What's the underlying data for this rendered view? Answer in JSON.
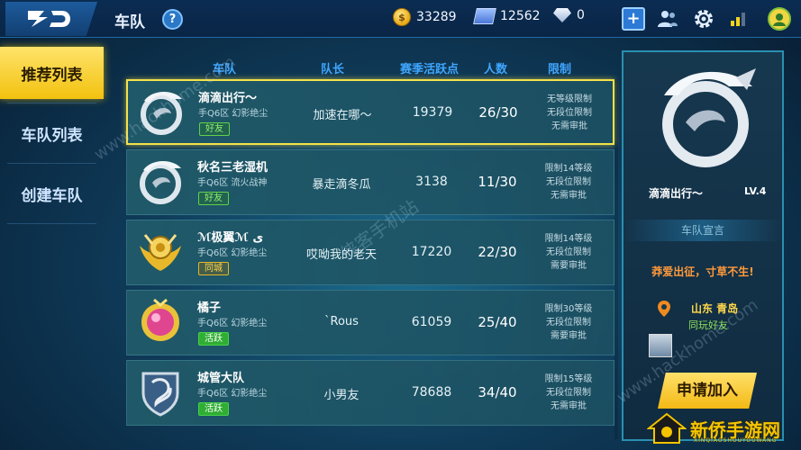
{
  "header": {
    "title": "车队",
    "help_label": "?",
    "coins": "33289",
    "vouchers": "12562",
    "diamonds": "0",
    "plus_label": "+"
  },
  "sidebar": {
    "items": [
      {
        "label": "推荐列表",
        "active": true
      },
      {
        "label": "车队列表",
        "active": false
      },
      {
        "label": "创建车队",
        "active": false
      }
    ]
  },
  "columns": {
    "team": "车队",
    "captain": "队长",
    "season_score": "赛季活跃点",
    "members": "人数",
    "limits": "限制"
  },
  "rows": [
    {
      "name": "滴滴出行～",
      "sub": "手Q6区 幻影绝尘",
      "badge": "好友",
      "badge_type": "friend",
      "captain": "加速在哪～",
      "score": "19379",
      "count": "26/30",
      "limit1": "无等级限制",
      "limit2": "无段位限制",
      "limit3": "无需审批",
      "selected": true
    },
    {
      "name": "秋名三老湿机",
      "sub": "手Q6区 流火战神",
      "badge": "好友",
      "badge_type": "friend",
      "captain": "暴走滴冬瓜",
      "score": "3138",
      "count": "11/30",
      "limit1": "限制14等级",
      "limit2": "无段位限制",
      "limit3": "无需审批",
      "selected": false
    },
    {
      "name": "ℳ极翼ℳ ى",
      "sub": "手Q6区 幻影绝尘",
      "badge": "同城",
      "badge_type": "city",
      "captain": "哎呦我的老天",
      "score": "17220",
      "count": "22/30",
      "limit1": "限制14等级",
      "limit2": "无段位限制",
      "limit3": "需要审批",
      "selected": false
    },
    {
      "name": "橘子",
      "sub": "手Q6区 幻影绝尘",
      "badge": "活跃",
      "badge_type": "active",
      "captain": "ˋRous",
      "score": "61059",
      "count": "25/40",
      "limit1": "限制30等级",
      "limit2": "无段位限制",
      "limit3": "需要审批",
      "selected": false
    },
    {
      "name": "城管大队",
      "sub": "手Q6区 幻影绝尘",
      "badge": "活跃",
      "badge_type": "active",
      "captain": "小男友",
      "score": "78688",
      "count": "34/40",
      "limit1": "限制15等级",
      "limit2": "无段位限制",
      "limit3": "无需审批",
      "selected": false
    }
  ],
  "panel": {
    "team_name": "滴滴出行～",
    "level": "LV.4",
    "section_title": "车队宣言",
    "slogan": "莽爱出征，寸草不生!",
    "location": "山东 青岛",
    "region_tag": "同玩好友",
    "apply_label": "申请加入"
  },
  "watermarks": {
    "w1": "www.hackhome.com",
    "w2": "www.hackhome.com",
    "w3": "侠客手机站"
  },
  "brand": {
    "name": "新侨手游网",
    "sub": "XINQIAOSHOUYOUWANG"
  },
  "colors": {
    "accent_yellow": "#f3c20f",
    "header_blue": "#3fa6ff",
    "friend_green": "#5fd14a",
    "active_green": "#2fae33",
    "city_gold": "#e5b52a"
  }
}
